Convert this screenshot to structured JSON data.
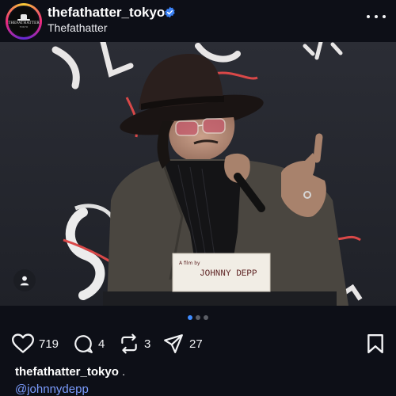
{
  "header": {
    "username": "thefathatter_tokyo",
    "subtitle": "Thefathatter",
    "avatar_text": "THEFATHATTER",
    "avatar_sub": "TOKYO",
    "verified_icon": "verified-badge-icon",
    "more_icon": "more-horizontal-icon"
  },
  "photo": {
    "placard_name": "JOHNNY DEPP",
    "placard_small": "A film by",
    "user_tag_icon": "person-icon",
    "page_indicator": {
      "count": 3,
      "active": 0
    }
  },
  "actions": {
    "like_count": "719",
    "comment_count": "4",
    "repost_count": "3",
    "share_count": "27",
    "like_icon": "heart-icon",
    "comment_icon": "comment-bubble-icon",
    "repost_icon": "repost-icon",
    "share_icon": "send-icon",
    "save_icon": "bookmark-icon"
  },
  "caption": {
    "username": "thefathatter_tokyo",
    "separator": ".",
    "mention": "@johnnydepp"
  },
  "colors": {
    "background": "#0d0f17",
    "accent_link": "#7b9cff",
    "verified": "#3b82f6",
    "dot_active": "#3f8cff"
  }
}
